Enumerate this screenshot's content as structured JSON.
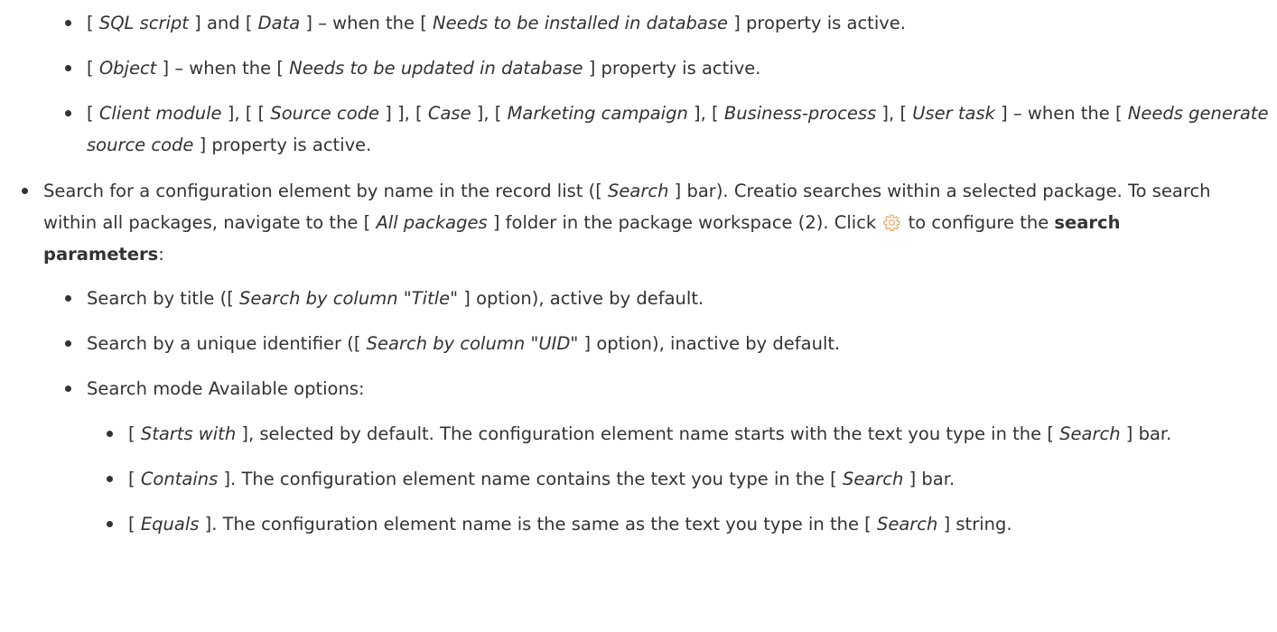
{
  "upper_list": {
    "item1": {
      "prefix": "[ ",
      "a": "SQL script",
      "mid": " ] and [ ",
      "b": "Data",
      "mid2": " ] – when the [ ",
      "c": "Needs to be installed in database",
      "suffix": " ] property is active."
    },
    "item2": {
      "prefix": "[ ",
      "a": "Object",
      "mid": " ] – when the [ ",
      "b": "Needs to be updated in database",
      "suffix": " ] property is active."
    },
    "item3": {
      "t0": "[ ",
      "a": "Client module",
      "t1": " ], [ [ ",
      "b": "Source code",
      "t2": " ] ], [ ",
      "c": "Case",
      "t3": " ], [ ",
      "d": "Marketing campaign",
      "t4": " ], [ ",
      "e": "Business-process",
      "t5": " ], [ ",
      "f": "User task",
      "t6": " ] – when the [ ",
      "g": "Needs generate source code",
      "t7": " ] property is active."
    }
  },
  "search_item": {
    "t0": "Search for a configuration element by name in the record list ([ ",
    "a": "Search",
    "t1": " ] bar). Creatio searches within a selected package. To search within all packages, navigate to the [ ",
    "b": "All packages",
    "t2": " ] folder in the package workspace (2). Click ",
    "t3": " to configure the ",
    "bold": "search parameters",
    "t4": ":",
    "gear_icon": "gear-icon",
    "gear_color": "#f0a868"
  },
  "search_params": {
    "item1": {
      "t0": "Search by title ([ ",
      "a": "Search by column \"Title\"",
      "t1": " ] option), active by default."
    },
    "item2": {
      "t0": "Search by a unique identifier ([ ",
      "a": "Search by column \"UID\"",
      "t1": " ] option), inactive by default."
    },
    "item3": {
      "text": "Search mode Available options:"
    }
  },
  "search_modes": {
    "item1": {
      "t0": "[ ",
      "a": "Starts with",
      "t1": " ], selected by default. The configuration element name starts with the text you type in the [ ",
      "b": "Search",
      "t2": " ] bar."
    },
    "item2": {
      "t0": "[ ",
      "a": "Contains",
      "t1": " ]. The configuration element name contains the text you type in the [ ",
      "b": "Search",
      "t2": " ] bar."
    },
    "item3": {
      "t0": "[ ",
      "a": "Equals",
      "t1": " ]. The configuration element name is the same as the text you type in the [ ",
      "b": "Search",
      "t2": " ] string."
    }
  }
}
